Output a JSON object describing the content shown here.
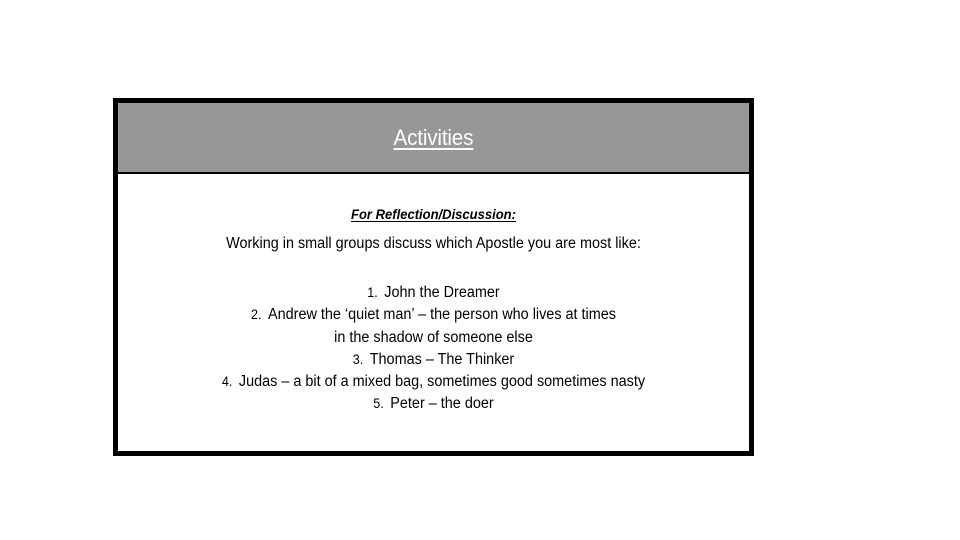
{
  "slide": {
    "background_color": "#ffffff",
    "box": {
      "border_color": "#000000",
      "banner_color": "#979797",
      "body_color": "#ffffff"
    }
  },
  "header": {
    "title": "Activities",
    "title_color": "#ffffff"
  },
  "body": {
    "reflection_heading": "For Reflection/Discussion:",
    "prompt": "Working in small groups discuss which Apostle you are most like:",
    "apostles": [
      {
        "number": "1.",
        "text": "John the Dreamer"
      },
      {
        "number": "2.",
        "text": "Andrew the ‘quiet man’ – the person who lives at times"
      },
      {
        "number": "",
        "text": "in the shadow of someone else"
      },
      {
        "number": "3.",
        "text": "Thomas – The Thinker"
      },
      {
        "number": "4.",
        "text": "Judas – a bit of a mixed bag, sometimes good sometimes nasty"
      },
      {
        "number": "5.",
        "text": "Peter – the doer"
      }
    ]
  }
}
